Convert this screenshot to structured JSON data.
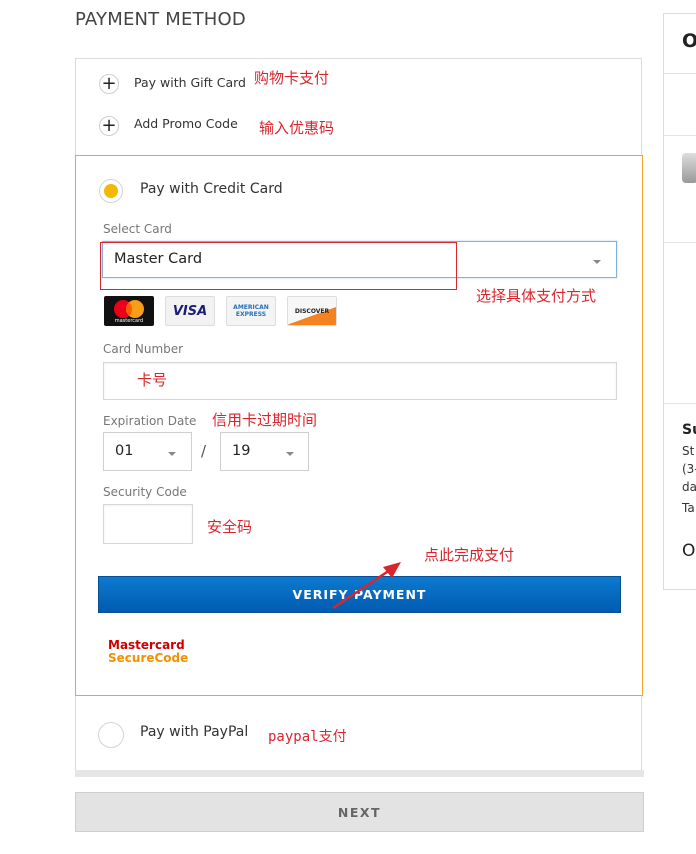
{
  "header": {
    "title": "PAYMENT METHOD"
  },
  "options": {
    "gift_card": {
      "label": "Pay with Gift Card",
      "annotation": "购物卡支付"
    },
    "promo": {
      "label": "Add Promo Code",
      "annotation": "输入优惠码"
    }
  },
  "credit_card": {
    "label": "Pay with Credit Card",
    "select_card_label": "Select Card",
    "selected_card": "Master Card",
    "select_annotation": "选择具体支付方式",
    "logos": [
      {
        "name": "mastercard",
        "text": "mastercard"
      },
      {
        "name": "visa",
        "text": "VISA"
      },
      {
        "name": "american-express",
        "text_line1": "AMERICAN",
        "text_line2": "EXPRESS"
      },
      {
        "name": "discover",
        "text": "DISCOVER"
      }
    ],
    "card_number_label": "Card Number",
    "card_number_annotation": "卡号",
    "card_number_value": "",
    "expiration_label": "Expiration Date",
    "expiration_annotation": "信用卡过期时间",
    "exp_month": "01",
    "exp_separator": "/",
    "exp_year": "19",
    "security_label": "Security Code",
    "security_annotation": "安全码",
    "security_value": "",
    "verify_button": "VERIFY PAYMENT",
    "verify_annotation": "点此完成支付",
    "securecode_line1": "Mastercard",
    "securecode_line2": "SecureCode"
  },
  "paypal": {
    "label": "Pay with PayPal",
    "annotation": "paypal支付"
  },
  "footer": {
    "next_button": "NEXT"
  },
  "side_panel": {
    "heading_fragment": "O",
    "summary_fragment": "Su",
    "lines": [
      "St",
      "(3-",
      "da",
      "Ta"
    ],
    "bottom_fragment": "O"
  },
  "colors": {
    "annotation_red": "#d9262d",
    "accent_orange": "#f0a42a",
    "radio_yellow": "#f5b800",
    "verify_blue": "#0a6cc2"
  }
}
